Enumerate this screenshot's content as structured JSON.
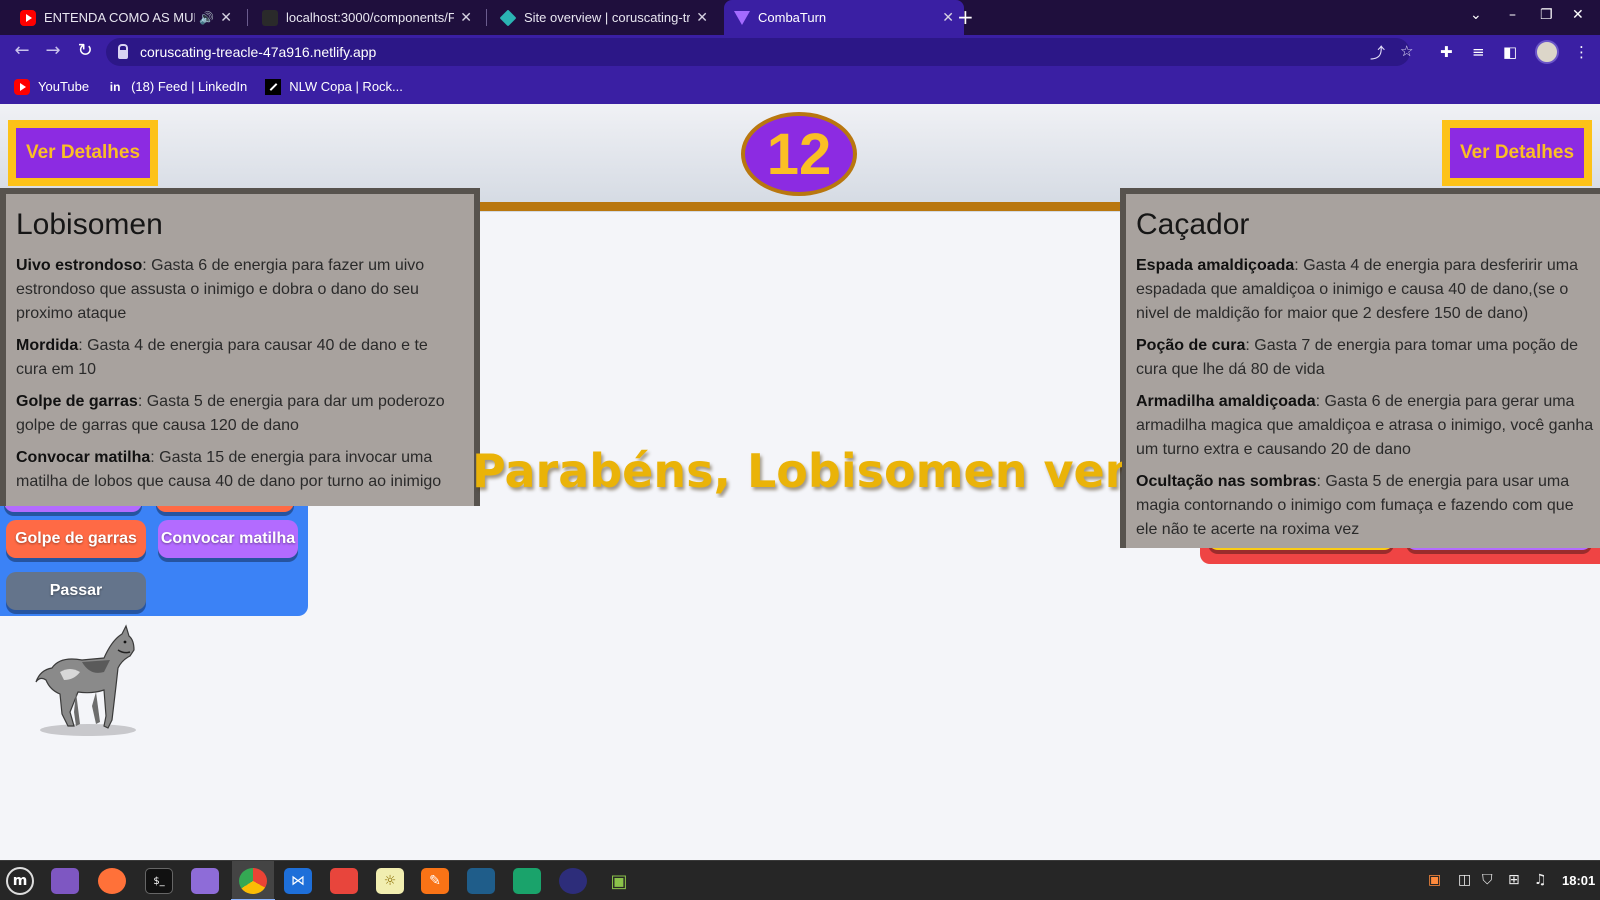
{
  "browser": {
    "tabs": [
      {
        "title": "ENTENDA COMO AS MULH",
        "icon": "youtube-icon",
        "audio": "🔊"
      },
      {
        "title": "localhost:3000/components/F",
        "icon": "dark-page-icon"
      },
      {
        "title": "Site overview | coruscating-tre",
        "icon": "netlify-icon"
      },
      {
        "title": "CombaTurn",
        "icon": "vite-icon"
      }
    ],
    "url": "coruscating-treacle-47a916.netlify.app",
    "bookmarks": [
      {
        "label": "YouTube",
        "icon": "youtube-icon"
      },
      {
        "label": "(18) Feed | LinkedIn",
        "icon": "linkedin-icon"
      },
      {
        "label": "NLW Copa | Rock...",
        "icon": "rocketseat-icon"
      }
    ]
  },
  "game": {
    "details_button_label": "Ver Detalhes",
    "turn": "12",
    "winner_message": "Parabéns, Lobisomen venceu",
    "left_player": {
      "name": "Lobisomen",
      "abilities": [
        {
          "name": "Uivo estrondoso",
          "desc": ": Gasta 6 de energia para fazer um uivo estrondoso que assusta o inimigo e dobra o dano do seu proximo ataque"
        },
        {
          "name": "Mordida",
          "desc": ": Gasta 4 de energia para causar 40 de dano e te cura em 10"
        },
        {
          "name": "Golpe de garras",
          "desc": ": Gasta 5 de energia para dar um poderozo golpe de garras que causa 120 de dano"
        },
        {
          "name": "Convocar matilha",
          "desc": ": Gasta 15 de energia para invocar uma matilha de lobos que causa 40 de dano por turno ao inimigo"
        }
      ],
      "buttons": [
        "Golpe de garras",
        "Convocar matilha",
        "Passar"
      ]
    },
    "right_player": {
      "name": "Caçador",
      "abilities": [
        {
          "name": "Espada amaldiçoada",
          "desc": ": Gasta 4 de energia para desferirir uma espadada que amaldiçoa o inimigo e causa 40 de dano,(se o nivel de maldição for maior que 2 desfere 150 de dano)"
        },
        {
          "name": "Poção de cura",
          "desc": ": Gasta 7 de energia para tomar uma poção de cura que lhe dá 80 de vida"
        },
        {
          "name": "Armadilha amaldiçoada",
          "desc": ": Gasta 6 de energia para gerar uma armadilha magica que amaldiçoa e atrasa o inimigo, você ganha um turno extra e causando 20 de dano"
        },
        {
          "name": "Ocultação nas sombras",
          "desc": ": Gasta 5 de energia para usar uma magia contornando o inimigo com fumaça e fazendo com que ele não te acerte na roxima vez"
        }
      ]
    }
  },
  "taskbar": {
    "clock": "18:01"
  }
}
